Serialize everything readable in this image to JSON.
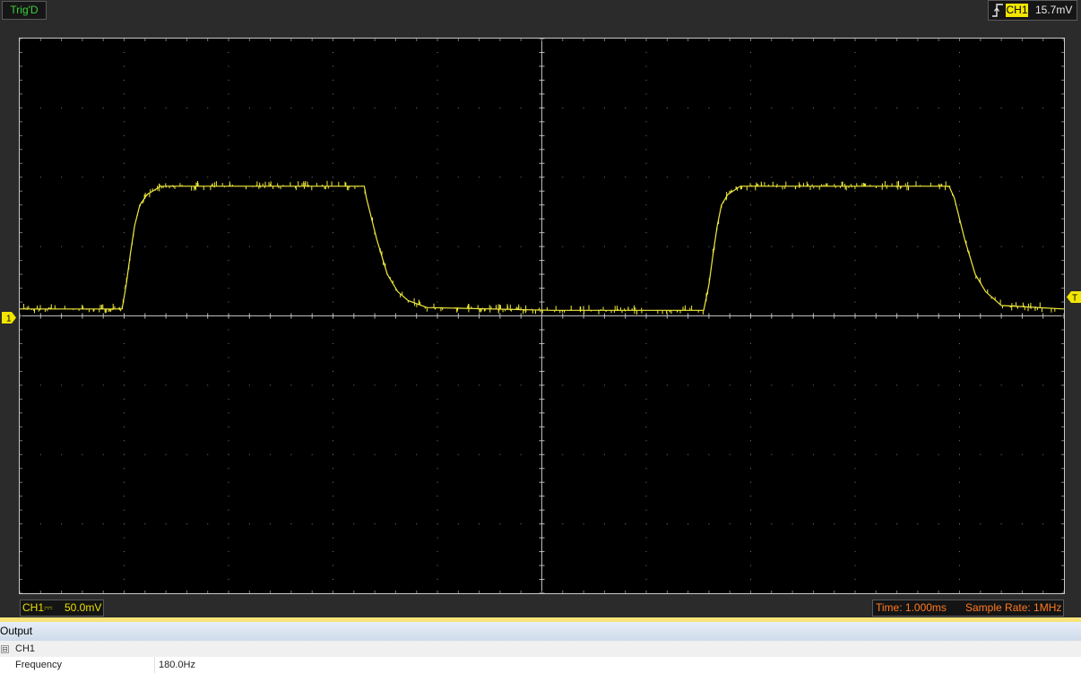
{
  "top_bar": {
    "trigger_status": "Trig'D",
    "trigger_channel": "CH1",
    "trigger_level": "15.7mV"
  },
  "scope": {
    "channel_marker": "1",
    "trigger_marker": "T",
    "trace_color": "#f0ea3c",
    "grid_color": "#7a7a7a",
    "divisions_x": 10,
    "divisions_y": 8
  },
  "chart_data": {
    "type": "line",
    "title": "",
    "xlabel": "",
    "ylabel": "",
    "x_unit": "div",
    "y_unit": "div",
    "xlim": [
      0,
      10
    ],
    "ylim": [
      -4,
      4
    ],
    "series": [
      {
        "x": [
          0,
          0.98,
          1.02,
          1.06,
          1.1,
          1.15,
          1.22,
          1.35,
          3.3,
          3.32,
          3.42,
          3.52,
          3.62,
          3.72,
          3.9,
          5.1,
          6.55,
          6.6,
          6.64,
          6.68,
          6.72,
          6.78,
          6.9,
          8.9,
          8.95,
          9.05,
          9.15,
          9.25,
          9.4,
          10
        ],
        "y": [
          0.1,
          0.1,
          0.45,
          0.9,
          1.3,
          1.6,
          1.75,
          1.87,
          1.87,
          1.7,
          1.1,
          0.6,
          0.35,
          0.22,
          0.12,
          0.08,
          0.08,
          0.45,
          0.9,
          1.3,
          1.6,
          1.75,
          1.87,
          1.87,
          1.7,
          1.1,
          0.6,
          0.35,
          0.15,
          0.1
        ]
      }
    ]
  },
  "status": {
    "channel": "CH1",
    "coupling_icon": "dc-coupling-icon",
    "volts_per_div": "50.0mV",
    "time": "Time: 1.000ms",
    "sample_rate": "Sample Rate: 1MHz"
  },
  "output": {
    "title": "Output",
    "group": "CH1",
    "expander": "⊟",
    "rows": [
      {
        "label": "Frequency",
        "value": "180.0Hz"
      }
    ]
  }
}
